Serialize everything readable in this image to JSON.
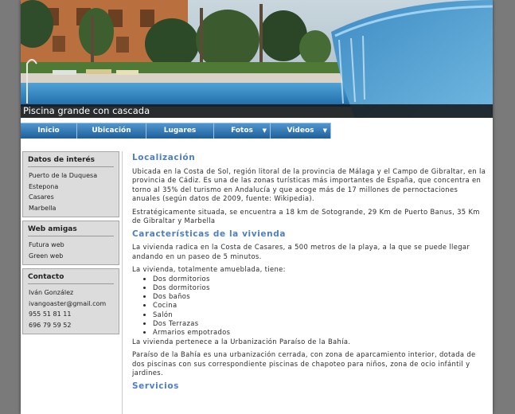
{
  "header": {
    "caption": "Piscina grande con cascada"
  },
  "nav": [
    {
      "label": "Inicio",
      "dropdown": false
    },
    {
      "label": "Ubicación",
      "dropdown": false
    },
    {
      "label": "Lugares",
      "dropdown": false
    },
    {
      "label": "Fotos",
      "dropdown": true
    },
    {
      "label": "Videos",
      "dropdown": true
    }
  ],
  "sidebar": {
    "interes": {
      "title": "Datos de interés",
      "links": [
        "Puerto de la Duquesa",
        "Estepona",
        "Casares",
        "Marbella"
      ]
    },
    "amigas": {
      "title": "Web amigas",
      "links": [
        "Futura web",
        "Green web"
      ]
    },
    "contacto": {
      "title": "Contacto",
      "lines": [
        "Iván González",
        "ivangoaster@gmail.com",
        "955 51 81 11",
        "696 79 59 52"
      ]
    }
  },
  "content": {
    "loc_title": "Localización",
    "loc_p1": "Ubicada en la Costa de Sol, región litoral de la provincia de Málaga y el Campo de Gibraltar, en la provincia de Cádiz. Es una de las zonas turísticas más importantes de España, que concentra en torno al 35% del turismo en Andalucía y que acoge más de 17 millones de pernoctaciones anuales (según datos de 2009, fuente: Wikipedia).",
    "loc_p2": "Estratégicamente situada, se encuentra a 18 km de Sotogrande, 29 Km de Puerto Banus, 35 Km de Gibraltar y Marbella",
    "car_title": "Características de la vivienda",
    "car_p1": "La vivienda radica en la Costa de Casares, a 500 metros de la playa, a la que se puede llegar andando en un paseo de 5 minutos.",
    "car_p2": "La vivienda, totalmente amueblada, tiene:",
    "items": [
      "Dos dormitorios",
      "Dos dormitorios",
      "Dos baños",
      "Cocina",
      "Salón",
      "Dos Terrazas",
      "Armarios empotrados"
    ],
    "car_p3": "La vivienda pertenece a la Urbanización Paraíso de la Bahía.",
    "car_p4": "Paraíso de la Bahía es una urbanización cerrada, con zona de aparcamiento interior, dotada de dos piscinas con sus correspondiente piscinas de chapoteo para niños, zona de ocio infántil y jardines.",
    "serv_title": "Servicios"
  },
  "colors": {
    "nav": "#2f75b5",
    "heading": "#4d7fc4",
    "sidebar_box": "#dcdcdc",
    "outer_bg": "#7a7a7a"
  }
}
